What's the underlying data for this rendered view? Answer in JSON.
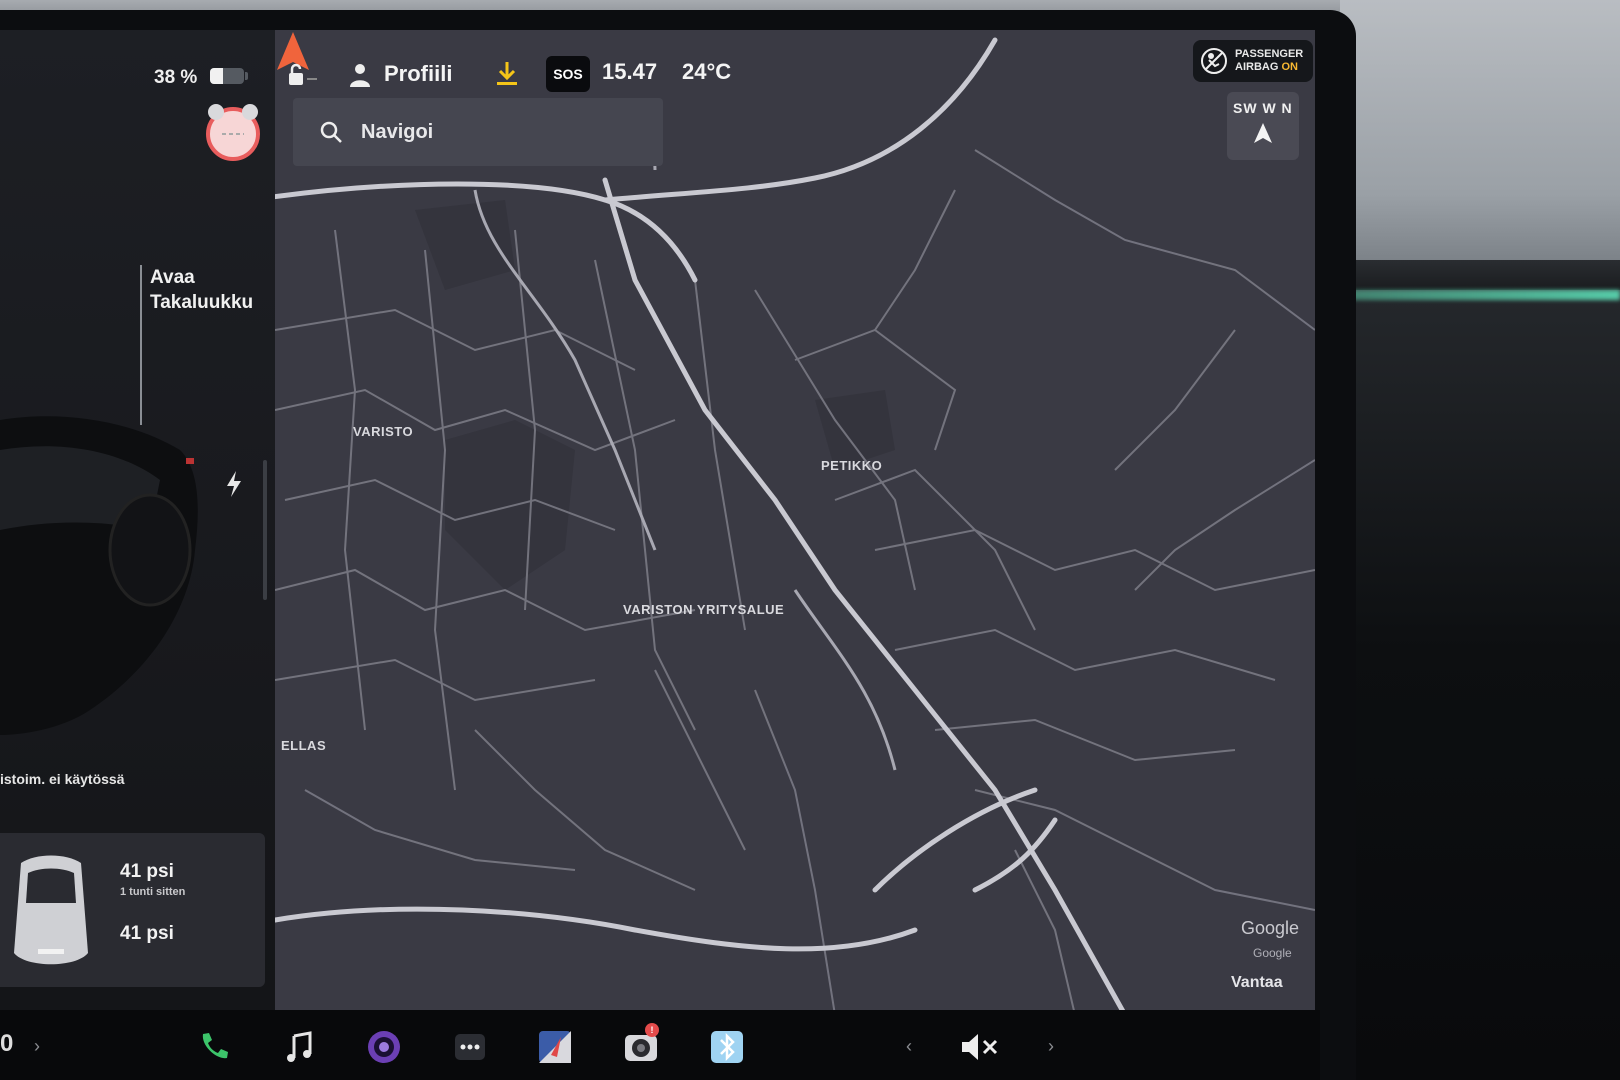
{
  "status_bar": {
    "battery_percent": "38 %",
    "battery_level": 0.38,
    "profile_label": "Profiili",
    "sos_label": "SOS",
    "time": "15.47",
    "temperature": "24°C"
  },
  "airbag": {
    "line1": "PASSENGER",
    "line2_prefix": "AIRBAG ",
    "line2_status": "ON"
  },
  "compass": {
    "letters": "SW  W  N"
  },
  "search": {
    "placeholder": "Navigoi"
  },
  "left_panel": {
    "trunk_label_line1": "Avaa",
    "trunk_label_line2": "Takaluukku",
    "status_text": "istoim. ei käytössä",
    "tire": {
      "front_psi": "41 psi",
      "front_time": "1 tunti sitten",
      "rear_psi": "41 psi"
    }
  },
  "map": {
    "labels": [
      "VARISTO",
      "PETIKKO",
      "VARISTON YRITYSALUE",
      "ELLAS"
    ],
    "attribution_logo": "Google",
    "attribution_small": "Google",
    "city": "Vantaa"
  },
  "dock": {
    "left_text": "0",
    "icons": [
      "phone-icon",
      "music-icon",
      "camera-app-icon",
      "more-icon",
      "navigation-app-icon",
      "dashcam-icon",
      "bluetooth-icon"
    ],
    "dashcam_badge": "!",
    "volume_state": "muted"
  },
  "colors": {
    "accent_orange": "#f0643c",
    "map_bg": "#3a3a44",
    "airbag_on": "#f7b731",
    "phone_green": "#3cc46a"
  }
}
